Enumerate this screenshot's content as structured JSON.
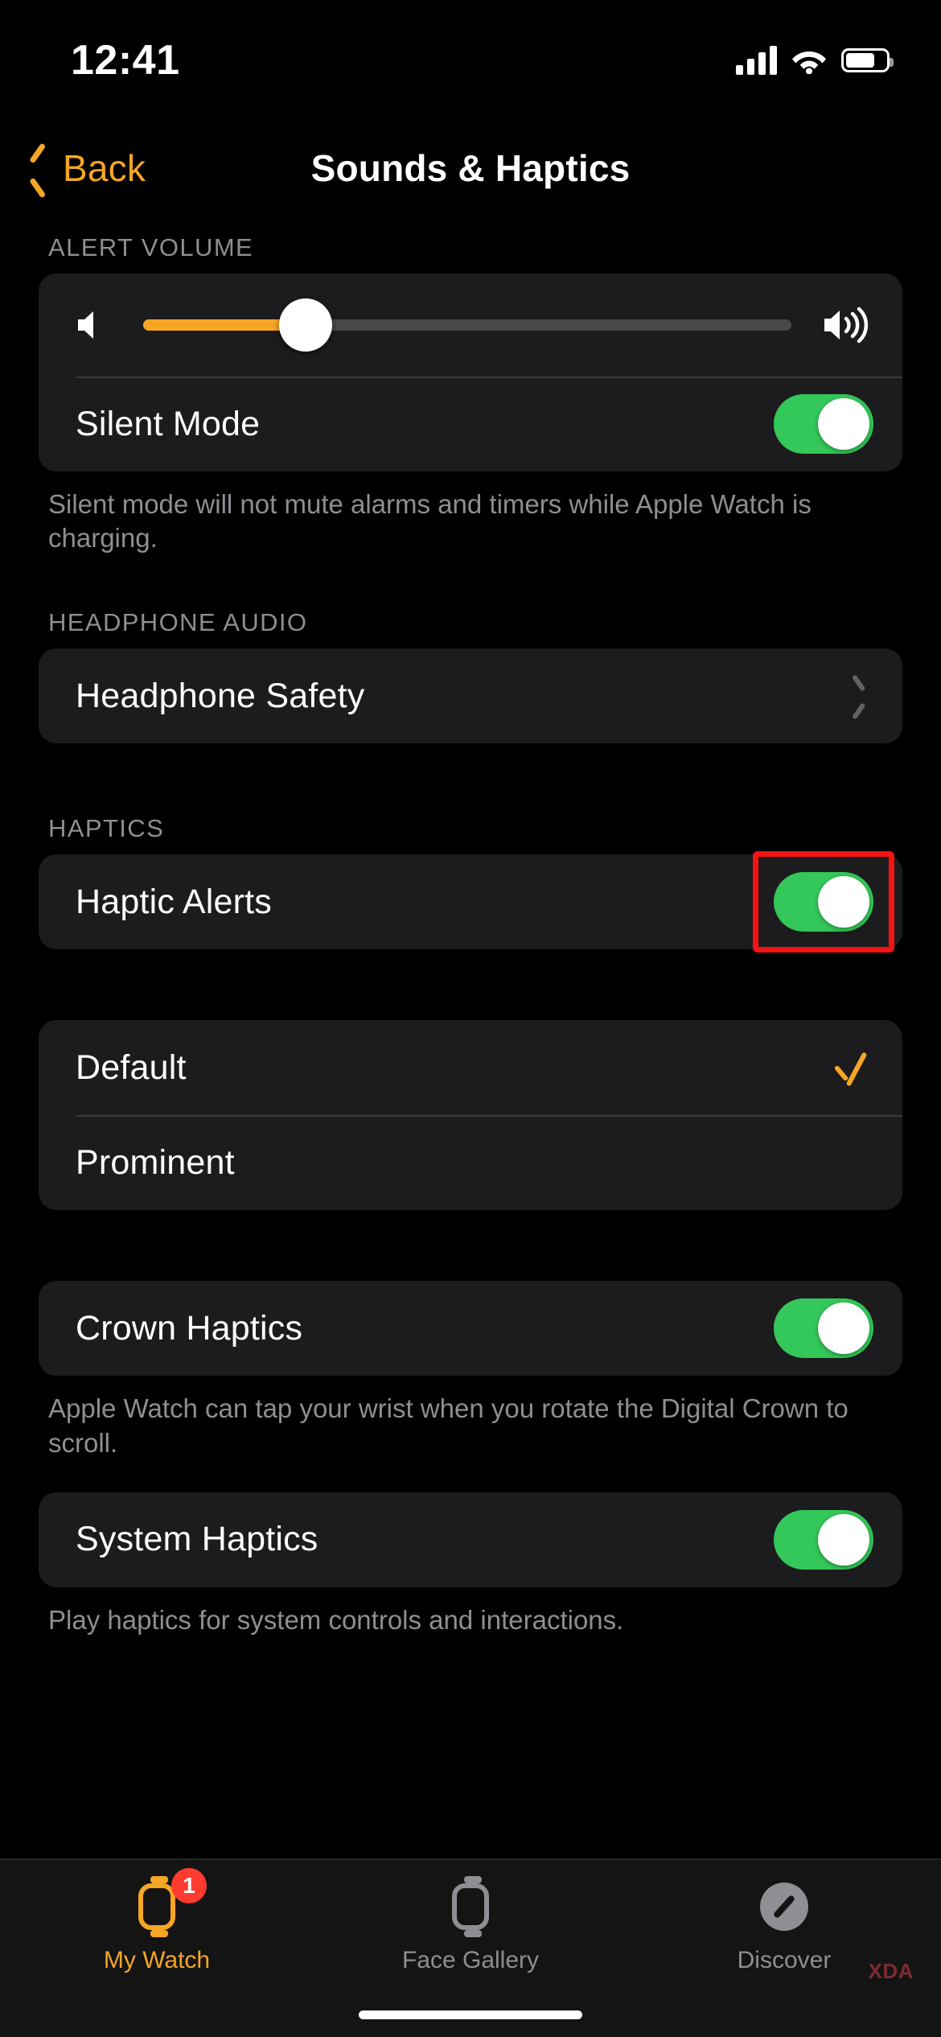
{
  "status_bar": {
    "time": "12:41",
    "cellular_icon": "cellular-bars-icon",
    "wifi_icon": "wifi-icon",
    "battery_icon": "battery-icon",
    "battery_level_pct": 72
  },
  "nav": {
    "back_label": "Back",
    "back_icon": "chevron-left-icon",
    "title": "Sounds & Haptics"
  },
  "sections": {
    "alert_volume": {
      "header": "ALERT VOLUME",
      "slider": {
        "min_icon": "speaker-low-icon",
        "max_icon": "speaker-high-icon",
        "value_pct": 25
      },
      "silent_mode": {
        "label": "Silent Mode",
        "toggle_on": true
      },
      "footer": "Silent mode will not mute alarms and timers while Apple Watch is charging."
    },
    "headphone_audio": {
      "header": "HEADPHONE AUDIO",
      "headphone_safety": {
        "label": "Headphone Safety",
        "accessory_icon": "chevron-right-icon"
      }
    },
    "haptics": {
      "header": "HAPTICS",
      "haptic_alerts": {
        "label": "Haptic Alerts",
        "toggle_on": true,
        "highlighted": true,
        "highlight_color": "#f51313"
      },
      "strength_options": [
        {
          "label": "Default",
          "selected": true,
          "check_icon": "checkmark-icon"
        },
        {
          "label": "Prominent",
          "selected": false,
          "check_icon": "checkmark-icon"
        }
      ],
      "crown_haptics": {
        "label": "Crown Haptics",
        "toggle_on": true,
        "footer": "Apple Watch can tap your wrist when you rotate the Digital Crown to scroll."
      },
      "system_haptics": {
        "label": "System Haptics",
        "toggle_on": true,
        "footer": "Play haptics for system controls and interactions."
      }
    }
  },
  "tab_bar": {
    "tabs": [
      {
        "label": "My Watch",
        "icon": "watch-icon",
        "active": true,
        "badge": "1"
      },
      {
        "label": "Face Gallery",
        "icon": "watch-face-icon",
        "active": false,
        "badge": ""
      },
      {
        "label": "Discover",
        "icon": "compass-icon",
        "active": false,
        "badge": ""
      }
    ]
  },
  "watermark": "XDA",
  "colors": {
    "accent_orange": "#f5a623",
    "toggle_green": "#34c759",
    "card_bg": "#1c1c1e",
    "secondary_text": "#8e8e93"
  }
}
